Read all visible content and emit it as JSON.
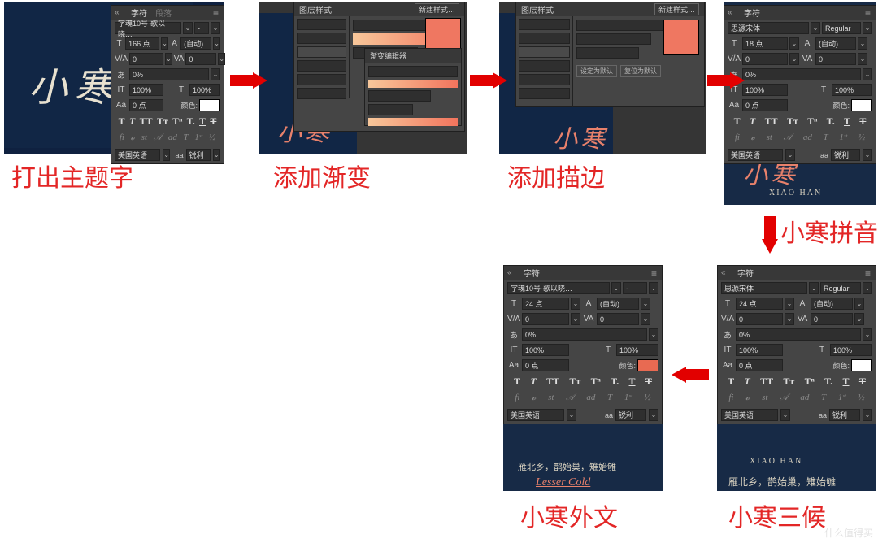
{
  "captions": {
    "c1": "打出主题字",
    "c2": "添加渐变",
    "c3": "添加描边",
    "c4": "小寒拼音",
    "c5": "小寒外文",
    "c6": "小寒三候"
  },
  "charPanel": {
    "tab1": "字符",
    "tab2": "段落",
    "fontA": "字魂10号-歌以晓…",
    "fontA_style": "-",
    "fontB": "思源宋体",
    "fontB_style": "Regular",
    "size_p1": "166 点",
    "size_p4": "18 点",
    "size_p5": "24 点",
    "size_p6": "24 点",
    "leading_auto": "(自动)",
    "tracking": "0",
    "kerning": "0",
    "ratio": "0%",
    "vscale": "100%",
    "hscale": "100%",
    "baseline": "0 点",
    "colorLabel": "颜色:",
    "lang": "美国英语",
    "aa": "锐利",
    "aa_label": "aa",
    "type_btns": [
      "T",
      "T",
      "TT",
      "Tr",
      "T",
      "T",
      "T",
      "T"
    ],
    "ot_btns": [
      "fi",
      "o",
      "st",
      "A",
      "ad",
      "T",
      "1st",
      "½"
    ]
  },
  "layerStyle": {
    "title1": "图层样式",
    "title2": "图层样式",
    "btn1": "新建样式…",
    "btn2": "设定为默认",
    "btn3": "复位为默认"
  },
  "art": {
    "xh": "小寒",
    "xh_py": "XIAO HAN",
    "sanhou": "雁北乡，鹊始巢，雉始雊",
    "lesser": "Lesser Cold"
  },
  "watermark": "什么值得买"
}
